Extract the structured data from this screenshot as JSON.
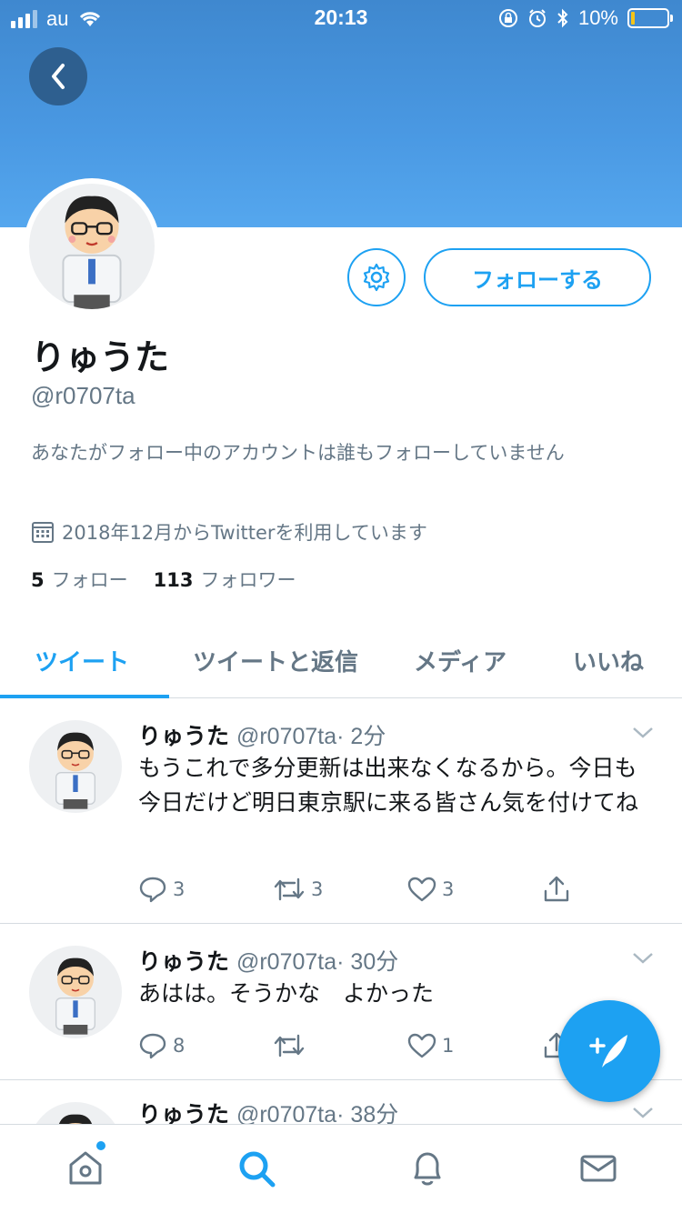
{
  "status_bar": {
    "carrier": "au",
    "time": "20:13",
    "battery": "10%"
  },
  "profile": {
    "display_name": "りゅうた",
    "handle": "@r0707ta",
    "follow_label": "フォローする",
    "notice": "あなたがフォロー中のアカウントは誰もフォローしていません",
    "joined": "2018年12月からTwitterを利用しています",
    "following_count": "5",
    "following_label": "フォロー",
    "followers_count": "113",
    "followers_label": "フォロワー"
  },
  "tabs": [
    {
      "label": "ツイート"
    },
    {
      "label": "ツイートと返信"
    },
    {
      "label": "メディア"
    },
    {
      "label": "いいね"
    }
  ],
  "tweets": [
    {
      "name": "りゅうた",
      "handle": "@r0707ta",
      "time": "· 2分",
      "text": "もうこれで多分更新は出来なくなるから。今日も今日だけど明日東京駅に来る皆さん気を付けてね",
      "replies": "3",
      "retweets": "3",
      "likes": "3"
    },
    {
      "name": "りゅうた",
      "handle": "@r0707ta",
      "time": "· 30分",
      "text": "あはは。そうかな　よかった",
      "replies": "8",
      "retweets": "",
      "likes": "1"
    },
    {
      "name": "りゅうた",
      "handle": "@r0707ta",
      "time": "· 38分"
    }
  ],
  "icons": {
    "back": "chevron-left-icon",
    "settings": "gear-icon",
    "calendar": "calendar-icon",
    "reply": "reply-icon",
    "retweet": "retweet-icon",
    "like": "heart-icon",
    "share": "share-icon",
    "compose": "compose-tweet-icon",
    "home": "home-icon",
    "search": "search-icon",
    "notifications": "bell-icon",
    "messages": "mail-icon"
  },
  "colors": {
    "accent": "#1da1f2",
    "banner": "#4a99e3",
    "secondary_text": "#657786"
  }
}
